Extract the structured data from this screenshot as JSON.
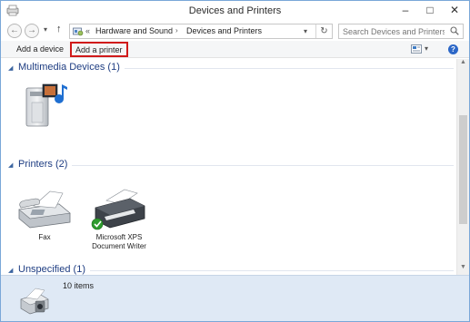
{
  "window": {
    "title": "Devices and Printers"
  },
  "titlebar": {
    "minimize": "–",
    "maximize": "□",
    "close": "✕"
  },
  "nav": {
    "back": "←",
    "forward": "→",
    "up": "↑",
    "history_dropdown": "▾"
  },
  "address": {
    "overflow": "«",
    "crumbs": [
      "Hardware and Sound",
      "Devices and Printers"
    ],
    "separator": "›",
    "dropdown": "▾",
    "refresh": "↻"
  },
  "search": {
    "placeholder": "Search Devices and Printers"
  },
  "toolbar": {
    "add_device": "Add a device",
    "add_printer": "Add a printer",
    "view_dropdown": "▾",
    "help": "?"
  },
  "groups": [
    {
      "title": "Multimedia Devices (1)",
      "devices": [
        {
          "name": "",
          "icon": "media-server-icon"
        }
      ]
    },
    {
      "title": "Printers (2)",
      "devices": [
        {
          "name": "Fax",
          "icon": "fax-icon"
        },
        {
          "name": "Microsoft XPS Document Writer",
          "icon": "printer-default-icon"
        }
      ]
    },
    {
      "title": "Unspecified (1)",
      "devices": []
    }
  ],
  "details": {
    "count": "10 items",
    "icon": "devices-printers-icon"
  },
  "colors": {
    "group_header": "#1e3d82",
    "details_pane": "#dfe9f5",
    "highlight_border": "#d01a1a",
    "window_border": "#7aa7d8"
  }
}
